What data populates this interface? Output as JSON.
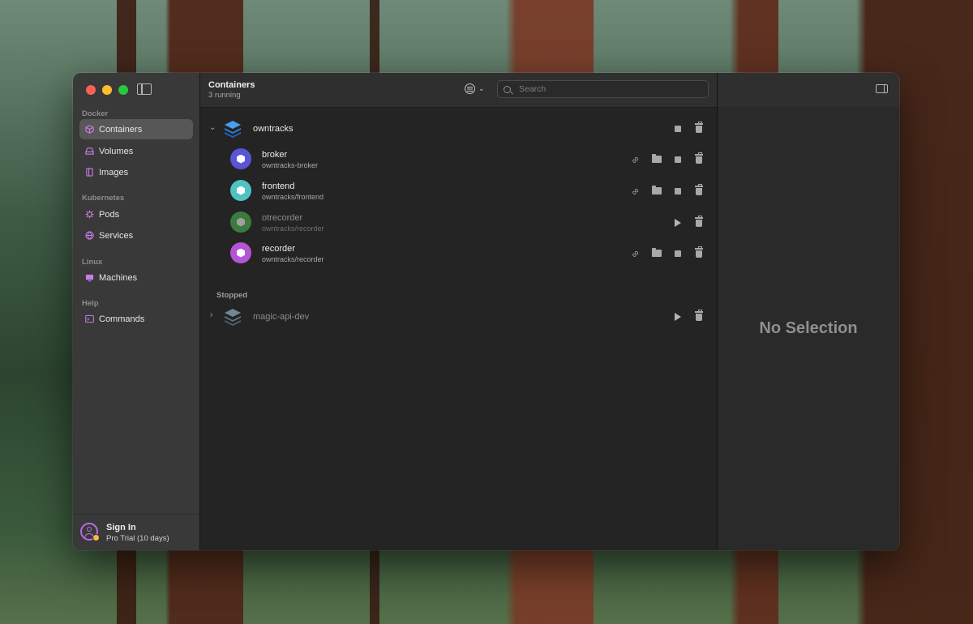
{
  "sidebar": {
    "sections": [
      {
        "title": "Docker",
        "items": [
          {
            "label": "Containers",
            "icon": "container-icon",
            "active": true
          },
          {
            "label": "Volumes",
            "icon": "volume-icon"
          },
          {
            "label": "Images",
            "icon": "image-icon"
          }
        ]
      },
      {
        "title": "Kubernetes",
        "items": [
          {
            "label": "Pods",
            "icon": "pod-icon"
          },
          {
            "label": "Services",
            "icon": "services-icon"
          }
        ]
      },
      {
        "title": "Linux",
        "items": [
          {
            "label": "Machines",
            "icon": "machine-icon"
          }
        ]
      },
      {
        "title": "Help",
        "items": [
          {
            "label": "Commands",
            "icon": "commands-icon"
          }
        ]
      }
    ],
    "account": {
      "title": "Sign In",
      "subtitle": "Pro Trial (10 days)"
    }
  },
  "toolbar": {
    "title": "Containers",
    "subtitle": "3 running",
    "search_placeholder": "Search"
  },
  "groups": {
    "running": {
      "name": "owntracks",
      "containers": [
        {
          "name": "broker",
          "image": "owntracks-broker",
          "color": "#5a55d6",
          "state": "running"
        },
        {
          "name": "frontend",
          "image": "owntracks/frontend",
          "color": "#4fc3c3",
          "state": "running"
        },
        {
          "name": "otrecorder",
          "image": "owntracks/recorder",
          "color": "#3b7b3d",
          "state": "stopped"
        },
        {
          "name": "recorder",
          "image": "owntracks/recorder",
          "color": "#b455d6",
          "state": "running"
        }
      ]
    },
    "stopped_label": "Stopped",
    "stopped": {
      "name": "magic-api-dev"
    }
  },
  "detail": {
    "empty_text": "No Selection"
  },
  "colors": {
    "accent": "#b86be0",
    "stack_blue": "#2f7fe0",
    "stack_gray": "#5d7680"
  }
}
